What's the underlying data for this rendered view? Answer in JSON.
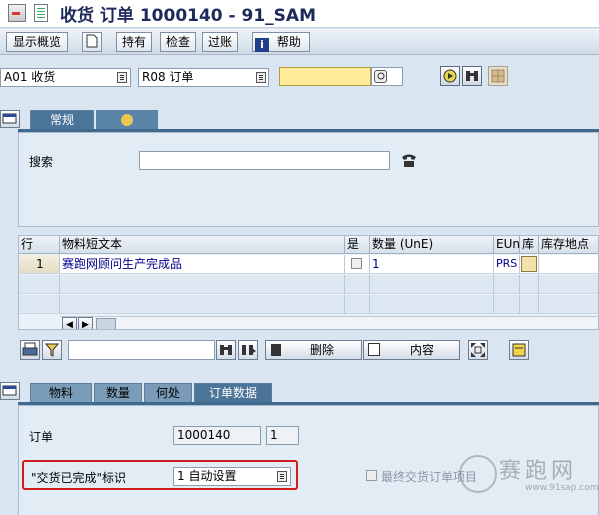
{
  "window": {
    "title": "收货 订单 1000140 - 91_SAM"
  },
  "toolbar": {
    "show_overview": "显示概览",
    "hold": "持有",
    "check": "检查",
    "post": "过账",
    "help": "帮助"
  },
  "selectors": {
    "action": "A01 收货",
    "reference": "R08 订单",
    "doc_value": ""
  },
  "header_panel": {
    "tabs": [
      {
        "label": "常规"
      }
    ],
    "search_label": "搜索",
    "search_value": ""
  },
  "items_grid": {
    "columns": [
      "行",
      "物料短文本",
      "是",
      "数量 (UnE)",
      "EUn",
      "库",
      "库存地点"
    ],
    "rows": [
      {
        "line": "1",
        "text": "赛跑网顾问生产完成品",
        "ok": false,
        "qty": "1",
        "eun": "PRS"
      }
    ]
  },
  "grid_toolbar": {
    "delete": "删除",
    "contents": "内容",
    "input_value": ""
  },
  "detail_panel": {
    "tabs": [
      {
        "label": "物料"
      },
      {
        "label": "数量"
      },
      {
        "label": "何处"
      },
      {
        "label": "订单数据"
      }
    ],
    "order_label": "订单",
    "order_number": "1000140",
    "order_item": "1",
    "delivery_completed_label": "\"交货已完成\"标识",
    "delivery_completed_value": "1 自动设置",
    "final_delivery_label": "最终交货订单项目"
  },
  "watermark": {
    "text": "赛跑网",
    "url": "www.91sap.com"
  },
  "colors": {
    "highlight": "#d21b1b",
    "tab_active": "#4a7498",
    "tab_inactive": "#7a9cb9"
  }
}
